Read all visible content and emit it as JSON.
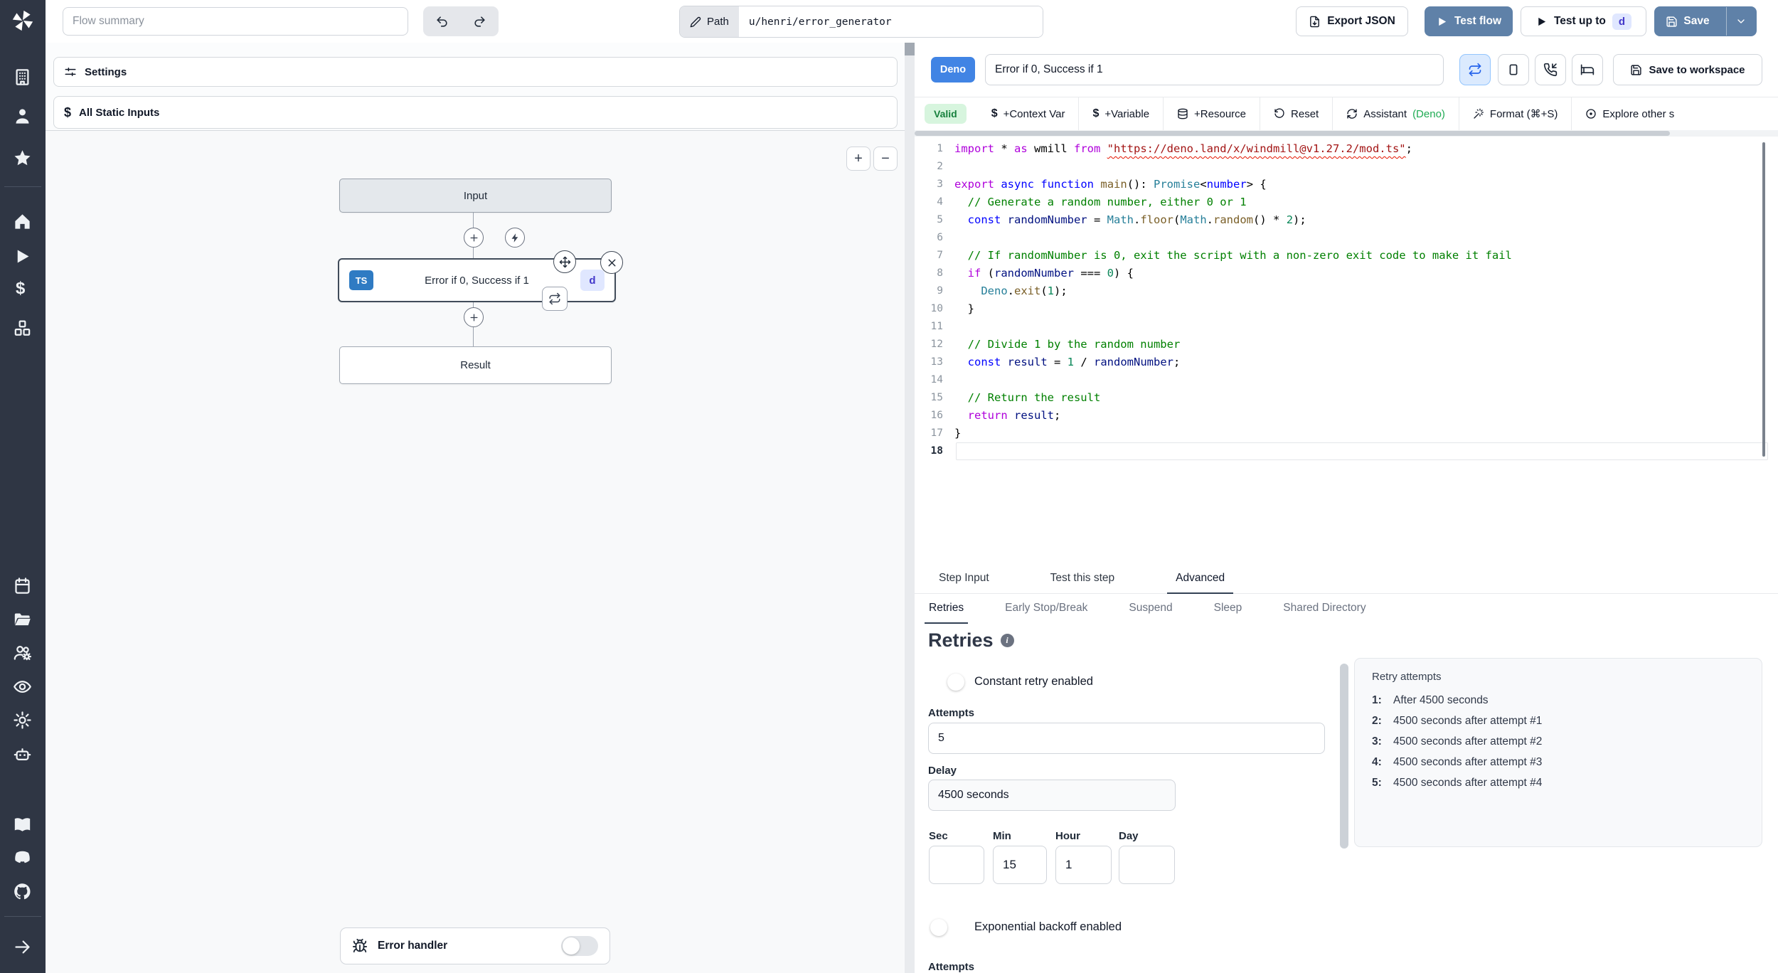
{
  "topbar": {
    "flow_summary_placeholder": "Flow summary",
    "path": {
      "label": "Path",
      "value": "u/henri/error_generator"
    },
    "buttons": {
      "export_json": "Export JSON",
      "test_flow": "Test flow",
      "test_up_to": "Test up to",
      "test_up_to_badge": "d",
      "save": "Save"
    }
  },
  "left_panel": {
    "settings_label": "Settings",
    "all_static_inputs_label": "All Static Inputs",
    "zoom_in": "+",
    "zoom_out": "−",
    "graph": {
      "input_node": "Input",
      "step_node": {
        "lang": "TS",
        "label": "Error if 0, Success if 1",
        "badge": "d"
      },
      "result_node": "Result"
    },
    "error_handler_label": "Error handler"
  },
  "step_editor": {
    "lang_badge": "Deno",
    "title_value": "Error if 0, Success if 1",
    "save_to_workspace": "Save to workspace",
    "toolbar": {
      "valid": "Valid",
      "context_var": "+Context Var",
      "variable": "+Variable",
      "resource": "+Resource",
      "reset": "Reset",
      "assistant": "Assistant",
      "assistant_lang": "(Deno)",
      "format": "Format (⌘+S)",
      "explore": "Explore other s"
    }
  },
  "tabs": {
    "main": [
      {
        "label": "Step Input"
      },
      {
        "label": "Test this step"
      },
      {
        "label": "Advanced"
      }
    ],
    "sub": [
      {
        "label": "Retries"
      },
      {
        "label": "Early Stop/Break"
      },
      {
        "label": "Suspend"
      },
      {
        "label": "Sleep"
      },
      {
        "label": "Shared Directory"
      }
    ]
  },
  "code": {
    "lines": [
      {
        "n": 1,
        "t": [
          [
            "kc",
            "import"
          ],
          [
            "pl",
            " * "
          ],
          [
            "kc",
            "as"
          ],
          [
            "pl",
            " wmill "
          ],
          [
            "kc",
            "from"
          ],
          [
            "pl",
            " "
          ],
          [
            "se",
            "\"https://deno.land/x/windmill@v1.27.2/mod.ts\""
          ],
          [
            "pl",
            ";"
          ]
        ]
      },
      {
        "n": 2,
        "t": []
      },
      {
        "n": 3,
        "t": [
          [
            "kc",
            "export"
          ],
          [
            "pl",
            " "
          ],
          [
            "kb",
            "async"
          ],
          [
            "pl",
            " "
          ],
          [
            "kb",
            "function"
          ],
          [
            "pl",
            " "
          ],
          [
            "fn",
            "main"
          ],
          [
            "pl",
            "(): "
          ],
          [
            "ty",
            "Promise"
          ],
          [
            "pl",
            "<"
          ],
          [
            "kb",
            "number"
          ],
          [
            "pl",
            "> {"
          ]
        ]
      },
      {
        "n": 4,
        "t": [
          [
            "cm",
            "  // Generate a random number, either 0 or 1"
          ]
        ]
      },
      {
        "n": 5,
        "t": [
          [
            "kb",
            "  const"
          ],
          [
            "vr",
            " randomNumber"
          ],
          [
            "pl",
            " = "
          ],
          [
            "ty",
            "Math"
          ],
          [
            "pl",
            "."
          ],
          [
            "fn",
            "floor"
          ],
          [
            "pl",
            "("
          ],
          [
            "ty",
            "Math"
          ],
          [
            "pl",
            "."
          ],
          [
            "fn",
            "random"
          ],
          [
            "pl",
            "() * "
          ],
          [
            "nu",
            "2"
          ],
          [
            "pl",
            ");"
          ]
        ]
      },
      {
        "n": 6,
        "t": []
      },
      {
        "n": 7,
        "t": [
          [
            "cm",
            "  // If randomNumber is 0, exit the script with a non-zero exit code to make it fail"
          ]
        ]
      },
      {
        "n": 8,
        "t": [
          [
            "kc",
            "  if"
          ],
          [
            "pl",
            " ("
          ],
          [
            "vr",
            "randomNumber"
          ],
          [
            "pl",
            " === "
          ],
          [
            "nu",
            "0"
          ],
          [
            "pl",
            ") {"
          ]
        ]
      },
      {
        "n": 9,
        "t": [
          [
            "pl",
            "    "
          ],
          [
            "ty",
            "Deno"
          ],
          [
            "pl",
            "."
          ],
          [
            "fn",
            "exit"
          ],
          [
            "pl",
            "("
          ],
          [
            "nu",
            "1"
          ],
          [
            "pl",
            ");"
          ]
        ]
      },
      {
        "n": 10,
        "t": [
          [
            "pl",
            "  }"
          ]
        ]
      },
      {
        "n": 11,
        "t": []
      },
      {
        "n": 12,
        "t": [
          [
            "cm",
            "  // Divide 1 by the random number"
          ]
        ]
      },
      {
        "n": 13,
        "t": [
          [
            "kb",
            "  const"
          ],
          [
            "vr",
            " result"
          ],
          [
            "pl",
            " = "
          ],
          [
            "nu",
            "1"
          ],
          [
            "pl",
            " / "
          ],
          [
            "vr",
            "randomNumber"
          ],
          [
            "pl",
            ";"
          ]
        ]
      },
      {
        "n": 14,
        "t": []
      },
      {
        "n": 15,
        "t": [
          [
            "cm",
            "  // Return the result"
          ]
        ]
      },
      {
        "n": 16,
        "t": [
          [
            "kc",
            "  return"
          ],
          [
            "vr",
            " result"
          ],
          [
            "pl",
            ";"
          ]
        ]
      },
      {
        "n": 17,
        "t": [
          [
            "pl",
            "}"
          ]
        ]
      },
      {
        "n": 18,
        "t": [],
        "active": true
      }
    ]
  },
  "retries": {
    "heading": "Retries",
    "constant_label": "Constant retry enabled",
    "attempts_label": "Attempts",
    "attempts_value": "5",
    "delay_label": "Delay",
    "delay_value": "4500 seconds",
    "time_fields": [
      {
        "label": "Sec",
        "value": ""
      },
      {
        "label": "Min",
        "value": "15"
      },
      {
        "label": "Hour",
        "value": "1"
      },
      {
        "label": "Day",
        "value": ""
      }
    ],
    "exponential_label": "Exponential backoff enabled",
    "clipped_label": "Attempts",
    "panel": {
      "title": "Retry attempts",
      "items": [
        {
          "n": "1:",
          "text": "After 4500 seconds"
        },
        {
          "n": "2:",
          "text": "4500 seconds after attempt #1"
        },
        {
          "n": "3:",
          "text": "4500 seconds after attempt #2"
        },
        {
          "n": "4:",
          "text": "4500 seconds after attempt #3"
        },
        {
          "n": "5:",
          "text": "4500 seconds after attempt #4"
        }
      ]
    }
  },
  "icons": {
    "accent_blue": "#5f81a8",
    "toggle_on": "#2563eb",
    "sidebar_bg": "#2f3644",
    "ts_badge_bg": "#2f7bc3",
    "deno_badge_bg": "#4184e4"
  }
}
